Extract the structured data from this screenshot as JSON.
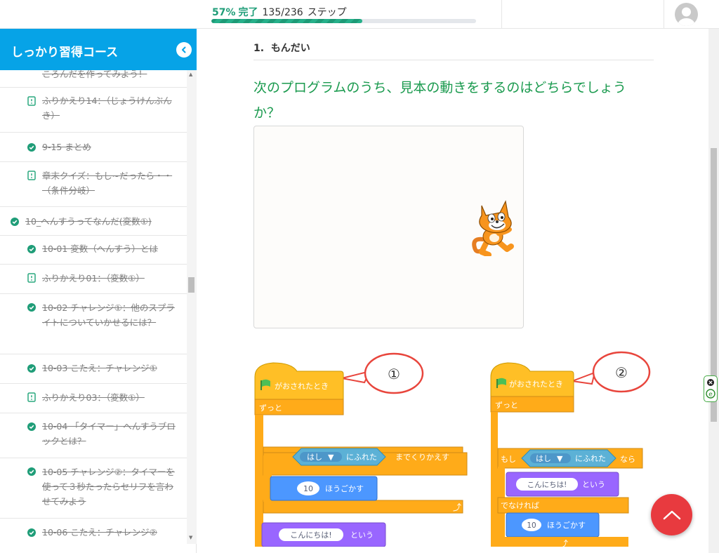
{
  "progress": {
    "percent_label": "57%",
    "done_label": "完了",
    "count": "135/236",
    "unit": "ステップ",
    "fraction": 0.57
  },
  "sidebar": {
    "title": "しっかり習得コース",
    "items": [
      {
        "label": "ころんだを作ってみよう！",
        "status": "check"
      },
      {
        "label": "ふりかえり14：（じょうけんぶんき）",
        "status": "quiz"
      },
      {
        "label": "9-15 まとめ",
        "status": "check"
      },
      {
        "label": "章末クイズ：もし~だったら・・（条件分岐）",
        "status": "quiz"
      },
      {
        "label": "10_へんすうってなんだ(変数①)",
        "status": "check"
      },
      {
        "label": "10-01 変数（へんすう）とは",
        "status": "check"
      },
      {
        "label": "ふりかえり01：（変数①）",
        "status": "quiz"
      },
      {
        "label": "10-02 チャレンジ①：他のスプライトについていかせるには？",
        "status": "check"
      },
      {
        "label": "10-03 こたえ：チャレンジ①",
        "status": "check"
      },
      {
        "label": "ふりかえり03：（変数①）",
        "status": "quiz"
      },
      {
        "label": "10-04 「タイマー」へんすうブロックとは？",
        "status": "check"
      },
      {
        "label": "10-05 チャレンジ②：タイマーを使って３秒たったらセリフを言わせてみよう",
        "status": "check"
      },
      {
        "label": "10-06 こたえ：チャレンジ②",
        "status": "check"
      }
    ]
  },
  "question": {
    "number": "1.",
    "heading": "もんだい",
    "text": "次のプログラムのうち、見本の動きをするのはどちらでしょうか？"
  },
  "programs": [
    {
      "callout": "①",
      "hat": "がおされたとき",
      "forever": "ずっと",
      "loop": "までくりかえす",
      "sensing_target": "はし",
      "sensing": "にふれた",
      "steps": "10",
      "move": "ほうごかす",
      "say_text": "こんにちは!",
      "say": "という"
    },
    {
      "callout": "②",
      "hat": "がおされたとき",
      "forever": "ずっと",
      "if": "もし",
      "sensing_target": "はし",
      "sensing": "にふれた",
      "then": "なら",
      "say_text": "こんにちは!",
      "say": "という",
      "else": "でなければ",
      "steps": "10",
      "move": "ほうごかす"
    }
  ],
  "colors": {
    "accent": "#06a3e7",
    "progress": "#1f9d78",
    "question": "#1a9a4e",
    "scroll_top": "#e83a3f",
    "block_event": "#ffbf26",
    "block_control": "#ffab19",
    "block_motion": "#4c97ff",
    "block_looks": "#9966ff",
    "block_sensing": "#5cb1d6"
  },
  "icons": {
    "check": "check-icon",
    "quiz": "quiz-icon",
    "collapse": "chevron-left-icon",
    "avatar": "user-avatar-icon",
    "scroll_top": "chevron-up-icon",
    "flag": "green-flag-icon",
    "loop_arrow": "loop-arrow-icon"
  }
}
